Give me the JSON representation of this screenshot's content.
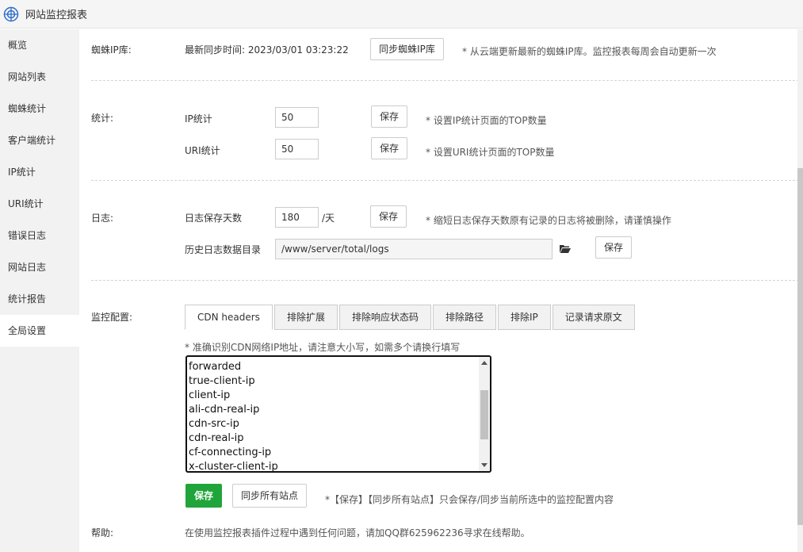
{
  "app": {
    "title": "网站监控报表"
  },
  "sidebar": {
    "items": [
      {
        "label": "概览"
      },
      {
        "label": "网站列表"
      },
      {
        "label": "蜘蛛统计"
      },
      {
        "label": "客户端统计"
      },
      {
        "label": "IP统计"
      },
      {
        "label": "URI统计"
      },
      {
        "label": "错误日志"
      },
      {
        "label": "网站日志"
      },
      {
        "label": "统计报告"
      },
      {
        "label": "全局设置",
        "active": true
      }
    ]
  },
  "spider": {
    "label": "蜘蛛IP库:",
    "sync_time": "最新同步时间: 2023/03/01 03:23:22",
    "sync_button": "同步蜘蛛IP库",
    "hint": "* 从云端更新最新的蜘蛛IP库。监控报表每周会自动更新一次"
  },
  "stats": {
    "label": "统计:",
    "ip_label": "IP统计",
    "ip_value": "50",
    "ip_save": "保存",
    "ip_hint": "* 设置IP统计页面的TOP数量",
    "uri_label": "URI统计",
    "uri_value": "50",
    "uri_save": "保存",
    "uri_hint": "* 设置URI统计页面的TOP数量"
  },
  "log": {
    "label": "日志:",
    "days_label": "日志保存天数",
    "days_value": "180",
    "days_unit": "/天",
    "days_save": "保存",
    "days_hint": "* 缩短日志保存天数原有记录的日志将被删除，请谨慎操作",
    "dir_label": "历史日志数据目录",
    "dir_value": "/www/server/total/logs",
    "dir_save": "保存"
  },
  "monitor": {
    "label": "监控配置:",
    "tabs": [
      {
        "label": "CDN headers",
        "active": true
      },
      {
        "label": "排除扩展"
      },
      {
        "label": "排除响应状态码"
      },
      {
        "label": "排除路径"
      },
      {
        "label": "排除IP"
      },
      {
        "label": "记录请求原文"
      }
    ],
    "hint": "* 准确识别CDN网络IP地址，请注意大小写，如需多个请换行填写",
    "headers": [
      "forwarded",
      "true-client-ip",
      "client-ip",
      "ali-cdn-real-ip",
      "cdn-src-ip",
      "cdn-real-ip",
      "cf-connecting-ip",
      "x-cluster-client-ip"
    ],
    "save_button": "保存",
    "sync_all_button": "同步所有站点",
    "footer_hint": "*【保存】【同步所有站点】只会保存/同步当前所选中的监控配置内容"
  },
  "help": {
    "label": "帮助:",
    "text": "在使用监控报表插件过程中遇到任何问题，请加QQ群625962236寻求在线帮助。"
  },
  "colors": {
    "accent": "#20a53a",
    "sidebar_bg": "#f2f2f2"
  }
}
